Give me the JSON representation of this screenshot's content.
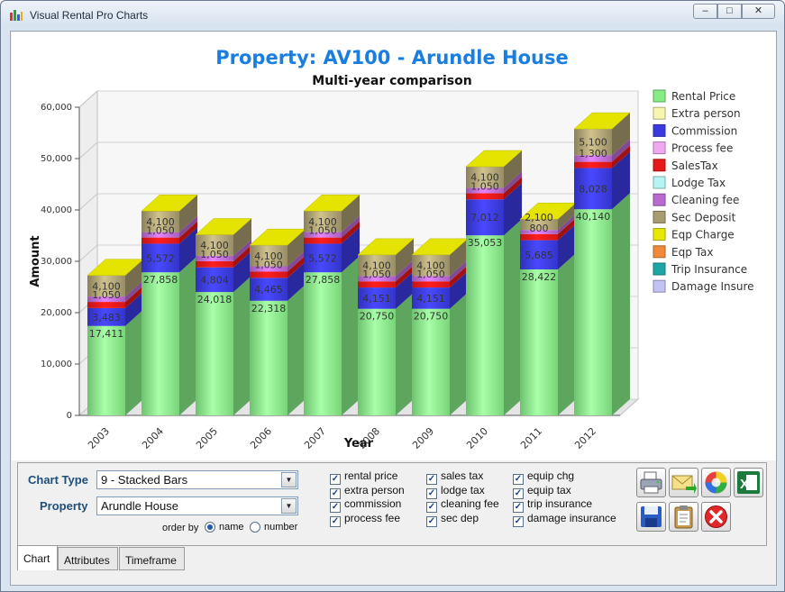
{
  "window": {
    "title": "Visual Rental Pro Charts",
    "controls": [
      "–",
      "□",
      "✕"
    ]
  },
  "chart_data": {
    "type": "bar",
    "stacked": true,
    "three_d": true,
    "title": "Property:  AV100 - Arundle House",
    "subtitle": "Multi-year comparison",
    "xlabel": "Year",
    "ylabel": "Amount",
    "ylim": [
      0,
      60000
    ],
    "yticks": [
      "0",
      "10,000",
      "20,000",
      "30,000",
      "40,000",
      "50,000",
      "60,000"
    ],
    "grid": true,
    "legend_position": "right",
    "categories": [
      "2003",
      "2004",
      "2005",
      "2006",
      "2007",
      "2008",
      "2009",
      "2010",
      "2011",
      "2012"
    ],
    "series": [
      {
        "name": "Rental Price",
        "color": "#86ec86",
        "values": [
          17411,
          27858,
          24018,
          22318,
          27858,
          20750,
          20750,
          35053,
          28422,
          40140
        ]
      },
      {
        "name": "Extra person",
        "color": "#f6f6b0",
        "values": [
          0,
          0,
          0,
          0,
          0,
          0,
          0,
          0,
          0,
          0
        ]
      },
      {
        "name": "Commission",
        "color": "#3a3ae0",
        "values": [
          3483,
          5572,
          4804,
          4465,
          5572,
          4151,
          4151,
          7012,
          5685,
          8028
        ]
      },
      {
        "name": "Process fee",
        "color": "#f0a8f0",
        "values": [
          0,
          0,
          0,
          0,
          0,
          0,
          0,
          0,
          0,
          0
        ]
      },
      {
        "name": "SalesTax",
        "color": "#e81818",
        "values": [
          1200,
          1200,
          1200,
          1200,
          1200,
          1200,
          1200,
          1200,
          1200,
          1200
        ]
      },
      {
        "name": "Lodge Tax",
        "color": "#b4f4f4",
        "values": [
          0,
          0,
          0,
          0,
          0,
          0,
          0,
          0,
          0,
          0
        ]
      },
      {
        "name": "Cleaning fee",
        "color": "#b86ad0",
        "values": [
          1050,
          1050,
          1050,
          1050,
          1050,
          1050,
          1050,
          1050,
          800,
          1300
        ]
      },
      {
        "name": "Sec Deposit",
        "color": "#a89c70",
        "values": [
          4100,
          4100,
          4100,
          4100,
          4100,
          4100,
          4100,
          4100,
          2100,
          5100
        ]
      },
      {
        "name": "Eqp Charge",
        "color": "#e8e800",
        "values": [
          0,
          0,
          0,
          0,
          0,
          0,
          0,
          0,
          0,
          0
        ]
      },
      {
        "name": "Eqp Tax",
        "color": "#f08a3a",
        "values": [
          0,
          0,
          0,
          0,
          0,
          0,
          0,
          0,
          0,
          0
        ]
      },
      {
        "name": "Trip Insurance",
        "color": "#1ea6a6",
        "values": [
          0,
          0,
          0,
          0,
          0,
          0,
          0,
          0,
          0,
          0
        ]
      },
      {
        "name": "Damage Insure",
        "color": "#c2c2f4",
        "values": [
          0,
          0,
          0,
          0,
          0,
          0,
          0,
          0,
          0,
          0
        ]
      }
    ],
    "data_labels": [
      {
        "series": "Rental Price",
        "values": [
          "17,411",
          "27,858",
          "24,018",
          "22,318",
          "27,858",
          "20,750",
          "20,750",
          "35,053",
          "28,422",
          "40,140"
        ]
      },
      {
        "series": "Commission",
        "values": [
          "3,483",
          "5,572",
          "4,804",
          "4,465",
          "5,572",
          "4,151",
          "4,151",
          "7,012",
          "5,685",
          "8,028"
        ]
      },
      {
        "series": "Cleaning fee",
        "values": [
          "1,050",
          "1,050",
          "1,050",
          "1,050",
          "1,050",
          "1,050",
          "1,050",
          "1,050",
          "800",
          "1,300"
        ]
      },
      {
        "series": "Sec Deposit",
        "values": [
          "4,100",
          "4,100",
          "4,100",
          "4,100",
          "4,100",
          "4,100",
          "4,100",
          "4,100",
          "2,100",
          "5,100"
        ]
      }
    ]
  },
  "controls": {
    "chart_type_label": "Chart Type",
    "chart_type_value": "9 - Stacked Bars",
    "property_label": "Property",
    "property_value": "Arundle House",
    "order_by_label": "order by",
    "order_by_options": [
      "name",
      "number"
    ],
    "order_by_selected": "name"
  },
  "checkboxes": [
    {
      "label": "rental price",
      "checked": true
    },
    {
      "label": "extra person",
      "checked": true
    },
    {
      "label": "commission",
      "checked": true
    },
    {
      "label": "process fee",
      "checked": true
    },
    {
      "label": "sales tax",
      "checked": true
    },
    {
      "label": "lodge tax",
      "checked": true
    },
    {
      "label": "cleaning fee",
      "checked": true
    },
    {
      "label": "sec dep",
      "checked": true
    },
    {
      "label": "equip chg",
      "checked": true
    },
    {
      "label": "equip tax",
      "checked": true
    },
    {
      "label": "trip insurance",
      "checked": true
    },
    {
      "label": "damage insurance",
      "checked": true
    }
  ],
  "tabs": [
    {
      "label": "Chart",
      "active": true
    },
    {
      "label": "Attributes",
      "active": false
    },
    {
      "label": "Timeframe",
      "active": false
    }
  ],
  "icons": [
    "printer-icon",
    "email-icon",
    "color-wheel-icon",
    "excel-icon",
    "save-icon",
    "clipboard-icon",
    "close-icon"
  ],
  "colors": {
    "title": "#1a7ee0",
    "accent_label": "#1f4e79"
  }
}
